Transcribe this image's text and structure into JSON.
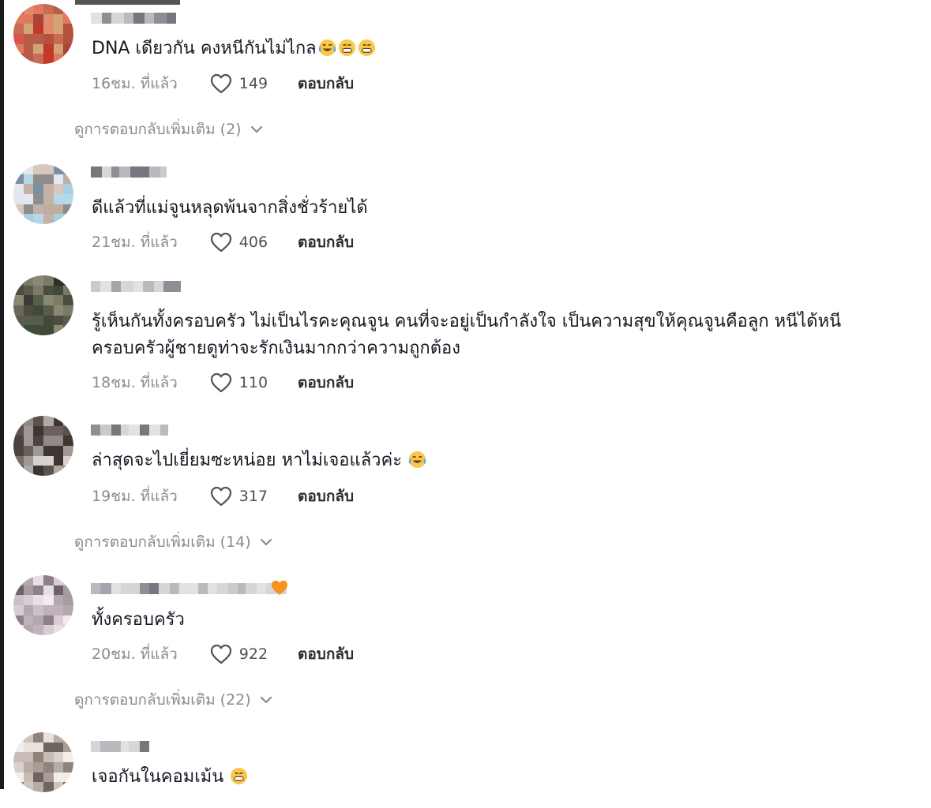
{
  "comments": [
    {
      "text": "DNA เดียวกัน คงหนีกันไม่ไกล",
      "emojis": [
        "tears-of-joy-emoji",
        "grinning-emoji",
        "grinning-emoji"
      ],
      "time": "16ชม. ที่แล้ว",
      "likes": "149",
      "reply_label": "ตอบกลับ"
    },
    {
      "text": "ดีแล้วที่แม่จูนหลุดพ้นจากสิ่งชั่วร้ายได้",
      "time": "21ชม. ที่แล้ว",
      "likes": "406",
      "reply_label": "ตอบกลับ"
    },
    {
      "text_line1": "รู้เห็นกันทั้งครอบครัว ไม่เป็นไรคะคุณจูน คนที่จะอยู่เป็นกำลังใจ เป็นความสุขให้คุณจูนคือลูก หนีได้หนี",
      "text_line2": "ครอบครัวผู้ชายดูท่าจะรักเงินมากกว่าความถูกต้อง",
      "time": "18ชม. ที่แล้ว",
      "likes": "110",
      "reply_label": "ตอบกลับ"
    },
    {
      "text": "ล่าสุดจะไปเยี่ยมซะหน่อย หาไม่เจอแล้วค่ะ",
      "emojis": [
        "tears-of-joy-emoji"
      ],
      "time": "19ชม. ที่แล้ว",
      "likes": "317",
      "reply_label": "ตอบกลับ"
    },
    {
      "text": "ทั้งครอบครัว",
      "username_emoji": "orange-heart-emoji",
      "time": "20ชม. ที่แล้ว",
      "likes": "922",
      "reply_label": "ตอบกลับ"
    },
    {
      "text": "เจอกันในคอมเม้น",
      "emojis": [
        "grinning-emoji"
      ]
    }
  ],
  "more_replies": [
    "ดูการตอบกลับเพิ่มเติม (2)",
    "ดูการตอบกลับเพิ่มเติม (14)",
    "ดูการตอบกลับเพิ่มเติม (22)"
  ],
  "colors": {
    "text": "#161823",
    "meta": "#8a8b91",
    "reply": "#2b2c33",
    "emoji_face": "#f7c948",
    "heart_orange": "#f7931e"
  }
}
